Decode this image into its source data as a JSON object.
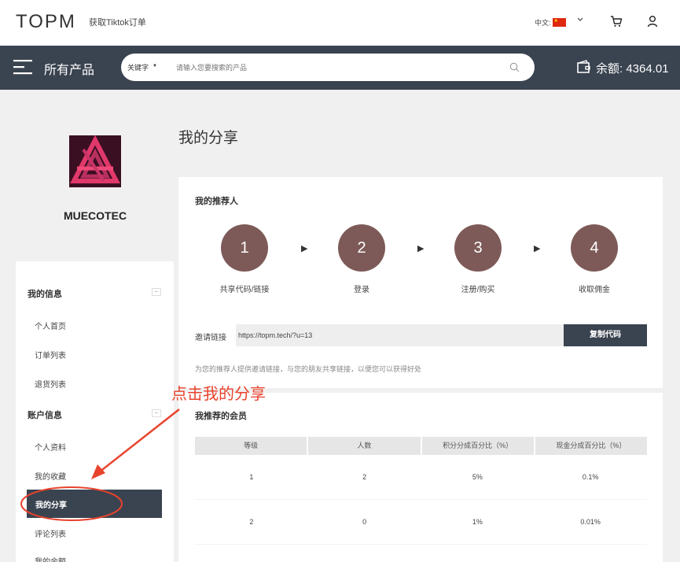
{
  "header": {
    "logo": "TOPM",
    "tiktok_link": "获取Tiktok订单",
    "language": "中文:",
    "cart_icon": "cart-icon",
    "user_icon": "user-icon"
  },
  "navbar": {
    "all_products": "所有产品",
    "search_keyword": "关键字",
    "search_placeholder": "请输入您要搜索的产品",
    "balance": "余额: 4364.01"
  },
  "profile": {
    "username": "MUECOTEC"
  },
  "sidebar": {
    "sections": [
      {
        "title": "我的信息",
        "collapse": "−",
        "items": [
          "个人首页",
          "订单列表",
          "退货列表"
        ]
      },
      {
        "title": "账户信息",
        "collapse": "−",
        "items": [
          "个人资料",
          "我的收藏",
          "我的分享",
          "评论列表",
          "我的余额"
        ]
      }
    ],
    "active_item": "我的分享"
  },
  "main": {
    "page_title": "我的分享",
    "referrer_title": "我的推荐人",
    "steps": [
      {
        "num": "1",
        "label": "共享代码/链接"
      },
      {
        "num": "2",
        "label": "登录"
      },
      {
        "num": "3",
        "label": "注册/购买"
      },
      {
        "num": "4",
        "label": "收取佣金"
      }
    ],
    "invite_label": "邀请链接",
    "invite_link": "https://topm.tech/?u=13",
    "copy_button": "复制代码",
    "invite_desc": "为您的推荐人提供邀请链接，与您的朋友共享链接，以便您可以获得好处",
    "members_title": "我推荐的会员",
    "table": {
      "headers": [
        "等级",
        "人数",
        "积分分成百分比（%）",
        "现金分成百分比（%）"
      ],
      "rows": [
        [
          "1",
          "2",
          "5%",
          "0.1%"
        ],
        [
          "2",
          "0",
          "1%",
          "0.01%"
        ]
      ]
    }
  },
  "annotation": {
    "text": "点击我的分享",
    "color": "#e8432d"
  }
}
